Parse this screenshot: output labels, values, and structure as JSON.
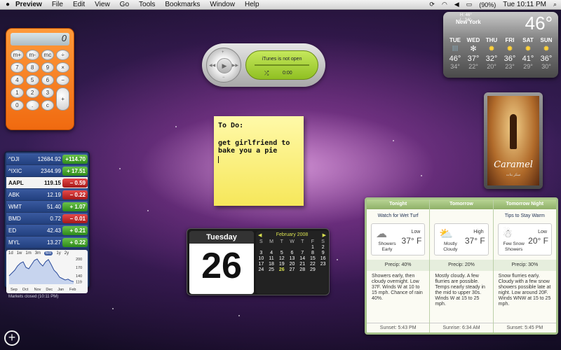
{
  "menubar": {
    "app_name": "Preview",
    "items": [
      "File",
      "Edit",
      "View",
      "Go",
      "Tools",
      "Bookmarks",
      "Window",
      "Help"
    ],
    "battery": "(90%)",
    "clock": "Tue 10:11 PM"
  },
  "calculator": {
    "display": "0",
    "keys": [
      "m+",
      "m-",
      "mc",
      "÷",
      "7",
      "8",
      "9",
      "×",
      "4",
      "5",
      "6",
      "−",
      "1",
      "2",
      "3",
      "+",
      "0",
      ".",
      "c",
      "="
    ]
  },
  "itunes": {
    "message": "iTunes is not open",
    "time": "0:00"
  },
  "sticky": {
    "line1": "To Do:",
    "line2": "get girlfriend to bake you a pie"
  },
  "weather": {
    "hi": "H: 46°",
    "lo": "L: 34°",
    "city": "New York",
    "temp": "46°",
    "days": [
      {
        "name": "TUE",
        "hi": "46°",
        "lo": "34°",
        "icon": "rain-icon"
      },
      {
        "name": "WED",
        "hi": "37°",
        "lo": "22°",
        "icon": "snow-icon"
      },
      {
        "name": "THU",
        "hi": "32°",
        "lo": "20°",
        "icon": "sun-icon"
      },
      {
        "name": "FRI",
        "hi": "36°",
        "lo": "23°",
        "icon": "sun-icon"
      },
      {
        "name": "SAT",
        "hi": "41°",
        "lo": "29°",
        "icon": "sun-icon"
      },
      {
        "name": "SUN",
        "hi": "36°",
        "lo": "30°",
        "icon": "sun-icon"
      }
    ]
  },
  "movie": {
    "title": "Caramel",
    "subtitle": "سكر بنات"
  },
  "stocks": {
    "rows": [
      {
        "sym": "^DJI",
        "price": "12684.92",
        "chg": "+114.70",
        "dir": "up",
        "style": "blue"
      },
      {
        "sym": "^IXIC",
        "price": "2344.99",
        "chg": "+ 17.51",
        "dir": "up",
        "style": "blue"
      },
      {
        "sym": "AAPL",
        "price": "119.15",
        "chg": "− 0.59",
        "dir": "down",
        "style": "white"
      },
      {
        "sym": "ABK",
        "price": "12.19",
        "chg": "− 0.22",
        "dir": "down",
        "style": "blue"
      },
      {
        "sym": "WMT",
        "price": "51.40",
        "chg": "+ 1.07",
        "dir": "up",
        "style": "blue"
      },
      {
        "sym": "BMD",
        "price": "0.72",
        "chg": "− 0.01",
        "dir": "down",
        "style": "blue"
      },
      {
        "sym": "ED",
        "price": "42.43",
        "chg": "+ 0.21",
        "dir": "up",
        "style": "blue"
      },
      {
        "sym": "MYL",
        "price": "13.27",
        "chg": "+ 0.22",
        "dir": "up",
        "style": "blue"
      }
    ],
    "ranges": [
      "1d",
      "1w",
      "1m",
      "3m",
      "6m",
      "1y",
      "2y"
    ],
    "selected_range": "6m",
    "status": "Markets closed (10:11 PM)"
  },
  "chart_data": {
    "type": "line",
    "title": "",
    "categories": [
      "Sep",
      "Oct",
      "Nov",
      "Dec",
      "Jan",
      "Feb"
    ],
    "y_ticks": [
      "200",
      "170",
      "140",
      "119"
    ],
    "ylim": [
      110,
      205
    ],
    "series": [
      {
        "values": [
          140,
          150,
          160,
          175,
          185,
          190,
          170,
          165,
          180,
          195,
          200,
          185,
          175,
          190,
          198,
          180,
          160,
          150,
          135,
          130,
          125,
          128,
          122,
          119
        ]
      }
    ]
  },
  "calendar": {
    "dayname": "Tuesday",
    "daynum": "26",
    "month": "February 2008",
    "headers": [
      "S",
      "M",
      "T",
      "W",
      "T",
      "F",
      "S"
    ],
    "days": [
      "",
      "",
      "",
      "",
      "",
      "1",
      "2",
      "3",
      "4",
      "5",
      "6",
      "7",
      "8",
      "9",
      "10",
      "11",
      "12",
      "13",
      "14",
      "15",
      "16",
      "17",
      "18",
      "19",
      "20",
      "21",
      "22",
      "23",
      "24",
      "25",
      "26",
      "27",
      "28",
      "29",
      ""
    ],
    "today": "26"
  },
  "forecast": {
    "columns": [
      {
        "head": "Tonight",
        "tip": "Watch for Wet Turf",
        "cond": "Showers Early",
        "label": "Low",
        "temp": "37° F",
        "precip": "Precip: 40%",
        "desc": "Showers early, then cloudy overnight. Low 37F. Winds W at 10 to 15 mph. Chance of rain 40%.",
        "sun": "Sunset: 5:43 PM"
      },
      {
        "head": "Tomorrow",
        "tip": "",
        "cond": "Mostly Cloudy",
        "label": "High",
        "temp": "37° F",
        "precip": "Precip: 20%",
        "desc": "Mostly cloudy. A few flurries are possible. Temps nearly steady in the mid to upper 30s. Winds W at 15 to 25 mph.",
        "sun": "Sunrise: 6:34 AM"
      },
      {
        "head": "Tomorrow Night",
        "tip": "Tips to Stay Warm",
        "cond": "Few Snow Showers",
        "label": "Low",
        "temp": "20° F",
        "precip": "Precip: 30%",
        "desc": "Snow flurries early. Cloudy with a few snow showers possible late at night. Low around 20F. Winds WNW at 15 to 25 mph.",
        "sun": "Sunset: 5:45 PM"
      }
    ]
  },
  "dashboard": {
    "add_symbol": "+"
  }
}
